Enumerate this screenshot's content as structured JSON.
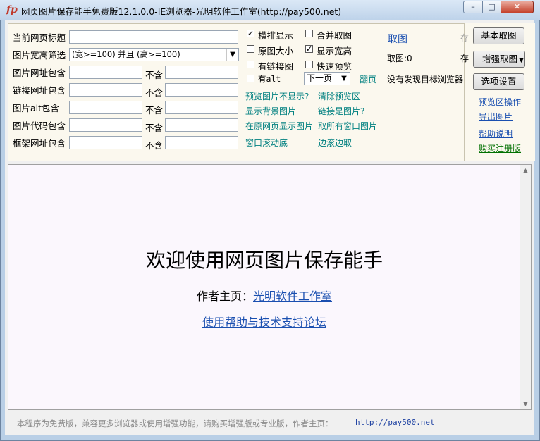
{
  "window": {
    "title": "网页图片保存能手免费版12.1.0.0-IE浏览器-光明软件工作室(http://pay500.net)",
    "controls": {
      "minimize": "–",
      "maximize": "□",
      "close": "✕"
    },
    "app_icon": "fp"
  },
  "filters": {
    "page_title_label": "当前网页标题",
    "page_title_value": "",
    "size_filter_label": "图片宽高筛选",
    "size_filter_value": "(宽>=100) 并且 (高>=100)",
    "image_url_label": "图片网址包含",
    "link_url_label": "链接网址包含",
    "alt_label": "图片alt包含",
    "code_label": "图片代码包含",
    "frame_label": "框架网址包含",
    "exclude_label": "不含"
  },
  "options": {
    "horizontal_display": {
      "label": "横排显示",
      "checked": true
    },
    "merge_fetch": {
      "label": "合并取图",
      "checked": false
    },
    "original_size": {
      "label": "原图大小",
      "checked": false
    },
    "show_dimensions": {
      "label": "显示宽高",
      "checked": true
    },
    "has_link": {
      "label": "有链接图",
      "checked": false
    },
    "quick_preview": {
      "label": "快速预览",
      "checked": false
    },
    "has_alt": {
      "label": "有alt",
      "checked": false
    },
    "page_select": "下一页",
    "page_turn": "翻页"
  },
  "actions": {
    "fetch_link": "取图",
    "fetch_count": "取图:0",
    "no_browser": "没有发现目标浏览器",
    "cut_char_1": "存",
    "cut_char_2": "存"
  },
  "links": {
    "preview_not_showing": "预览图片不显示?",
    "clear_preview": "清除预览区",
    "show_background": "显示背景图片",
    "link_is_image": "链接是图片?",
    "show_in_original": "在原网页显示图片",
    "fetch_all_windows": "取所有窗口图片",
    "scroll_bottom": "窗口滚动底",
    "scroll_while_fetch": "边滚边取"
  },
  "right_panel": {
    "basic_fetch": "基本取图",
    "enhanced_fetch": "增强取图",
    "options_settings": "选项设置",
    "preview_ops": "预览区操作",
    "export_images": "导出图片",
    "help": "帮助说明",
    "buy": "购买注册版"
  },
  "browser": {
    "welcome": "欢迎使用网页图片保存能手",
    "author_prefix": "作者主页：",
    "author_link": "光明软件工作室",
    "forum_link": "使用帮助与技术支持论坛"
  },
  "status": {
    "text": "本程序为免费版，兼容更多浏览器或使用增强功能，请购买增强版或专业版，作者主页：",
    "url": "http://pay500.net"
  }
}
